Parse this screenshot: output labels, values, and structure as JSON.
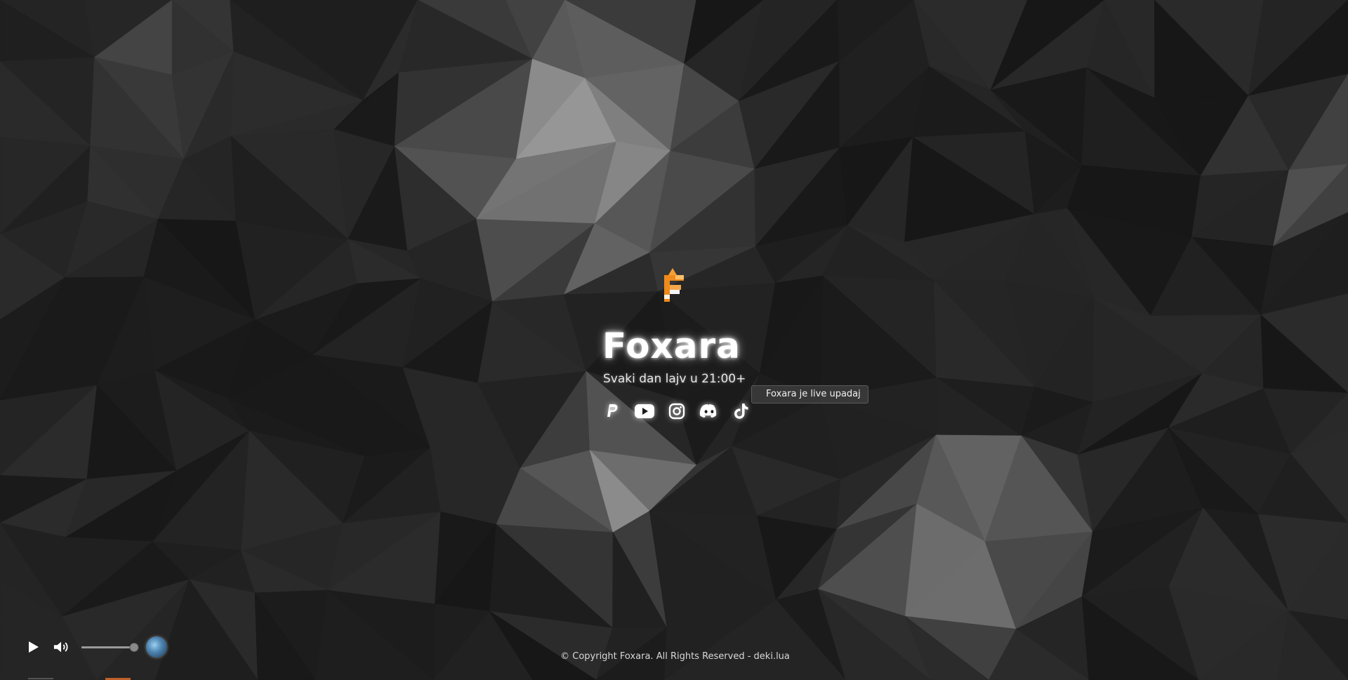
{
  "site": {
    "title": "Foxara",
    "subtitle": "Svaki dan lajv u 21:00+",
    "live_badge": "Foxara je live upadaj"
  },
  "socials": [
    {
      "icon": "paypal-icon"
    },
    {
      "icon": "youtube-icon"
    },
    {
      "icon": "instagram-icon"
    },
    {
      "icon": "discord-icon"
    },
    {
      "icon": "tiktok-icon"
    }
  ],
  "player": {
    "play_icon": "play-icon",
    "volume_icon": "volume-icon",
    "volume_level": 1.0
  },
  "footer": {
    "copyright": "© Copyright Foxara. All Rights Reserved - deki.lua"
  },
  "colors": {
    "background": "#1c1c1c",
    "logo_orange": "#f08a1c",
    "text": "#ffffff"
  }
}
